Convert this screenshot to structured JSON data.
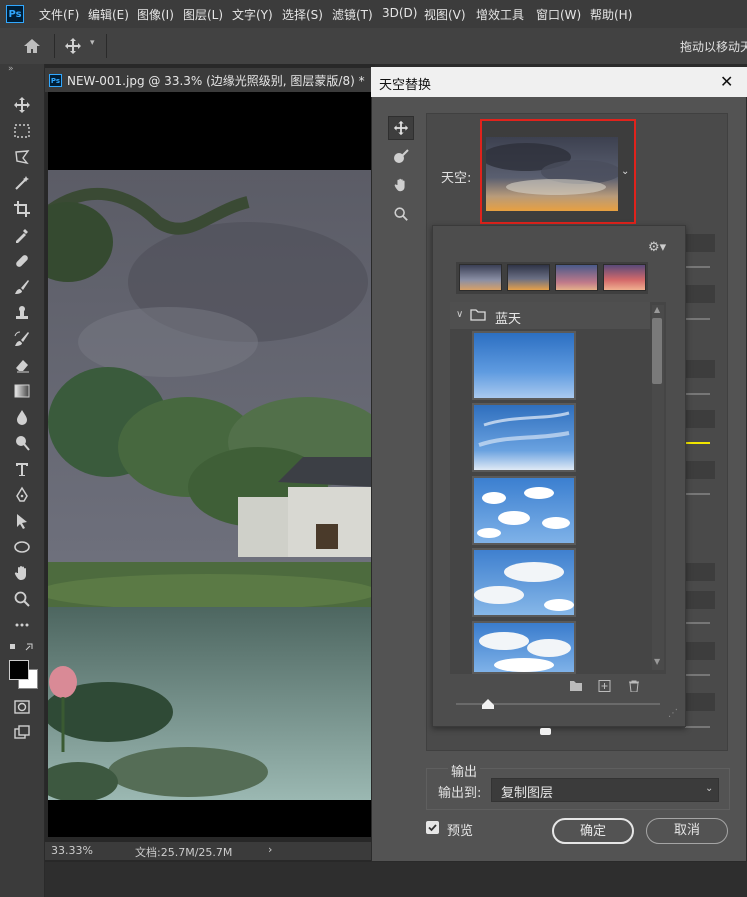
{
  "menu": {
    "logo": "Ps",
    "items": [
      "文件(F)",
      "编辑(E)",
      "图像(I)",
      "图层(L)",
      "文字(Y)",
      "选择(S)",
      "滤镜(T)",
      "3D(D)",
      "视图(V)",
      "增效工具",
      "窗口(W)",
      "帮助(H)"
    ]
  },
  "options_bar": {
    "hint": "拖动以移动天"
  },
  "document": {
    "tab_title": "NEW-001.jpg @ 33.3% (边缘光照级别, 图层蒙版/8) *",
    "zoom": "33.33%",
    "doc_size": "文档:25.7M/25.7M",
    "status_arrow": "›"
  },
  "dialog": {
    "title": "天空替换",
    "close": "✕",
    "sky_label": "天空:",
    "folder_name": "蓝天",
    "output_group": "输出",
    "output_to_label": "输出到:",
    "output_to_value": "复制图层",
    "preview_label": "预览",
    "preview_checked": true,
    "ok_label": "确定",
    "cancel_label": "取消"
  },
  "colors": {
    "highlight_border": "#e0231c",
    "accent_slider": "#f2e600"
  }
}
